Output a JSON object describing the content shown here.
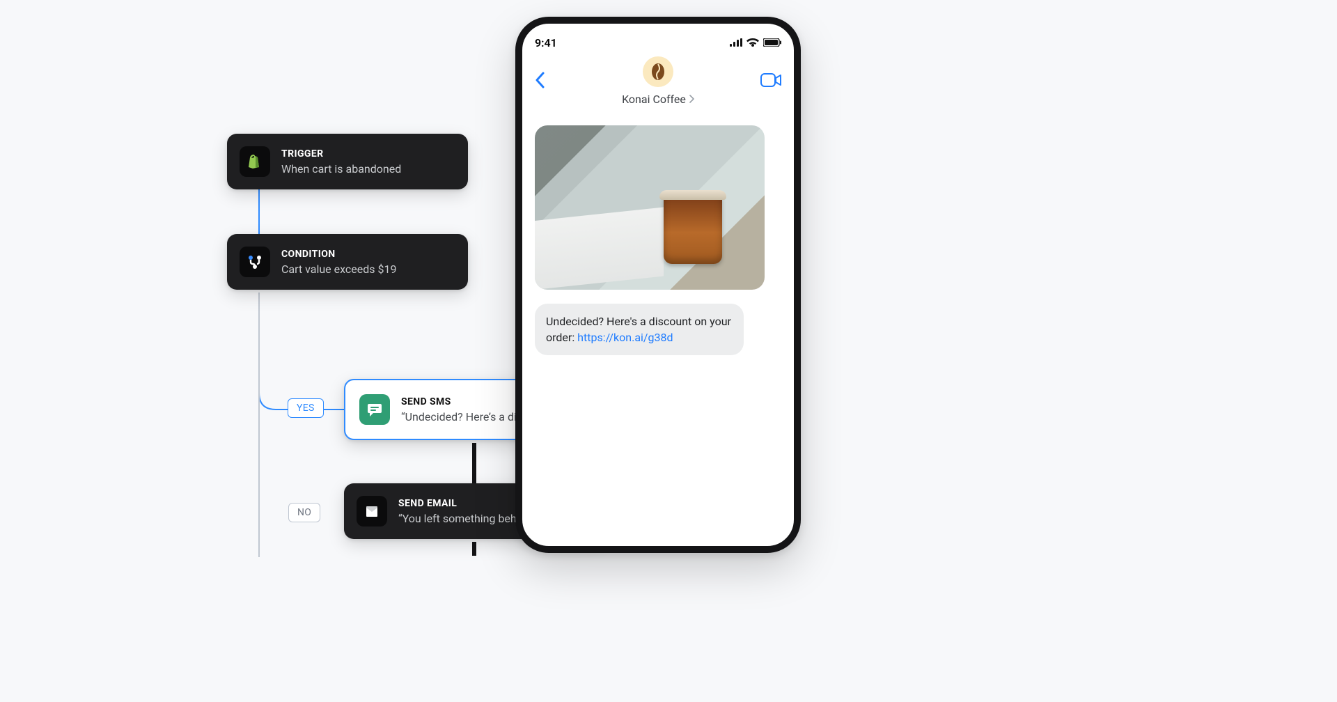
{
  "flow": {
    "trigger": {
      "title": "TRIGGER",
      "subtitle": "When cart is abandoned",
      "iconName": "shopify-icon"
    },
    "condition": {
      "title": "CONDITION",
      "subtitle": "Cart value exceeds $19",
      "iconName": "branch-icon"
    },
    "yesLabel": "YES",
    "noLabel": "NO",
    "sendSms": {
      "title": "SEND SMS",
      "subtitle": "“Undecided? Here’s a discount”",
      "iconName": "chat-icon"
    },
    "sendEmail": {
      "title": "SEND EMAIL",
      "subtitle": "“You left something behind”",
      "iconName": "mail-icon"
    }
  },
  "phone": {
    "time": "9:41",
    "contactName": "Konai Coffee",
    "message": {
      "textBefore": "Undecided? Here's a discount on your order: ",
      "linkText": "https://kon.ai/g38d"
    }
  },
  "colors": {
    "accent": "#2f8bff",
    "darkNode": "#1f1f21",
    "teal": "#2f9e74",
    "phoneFrame": "#141416"
  }
}
